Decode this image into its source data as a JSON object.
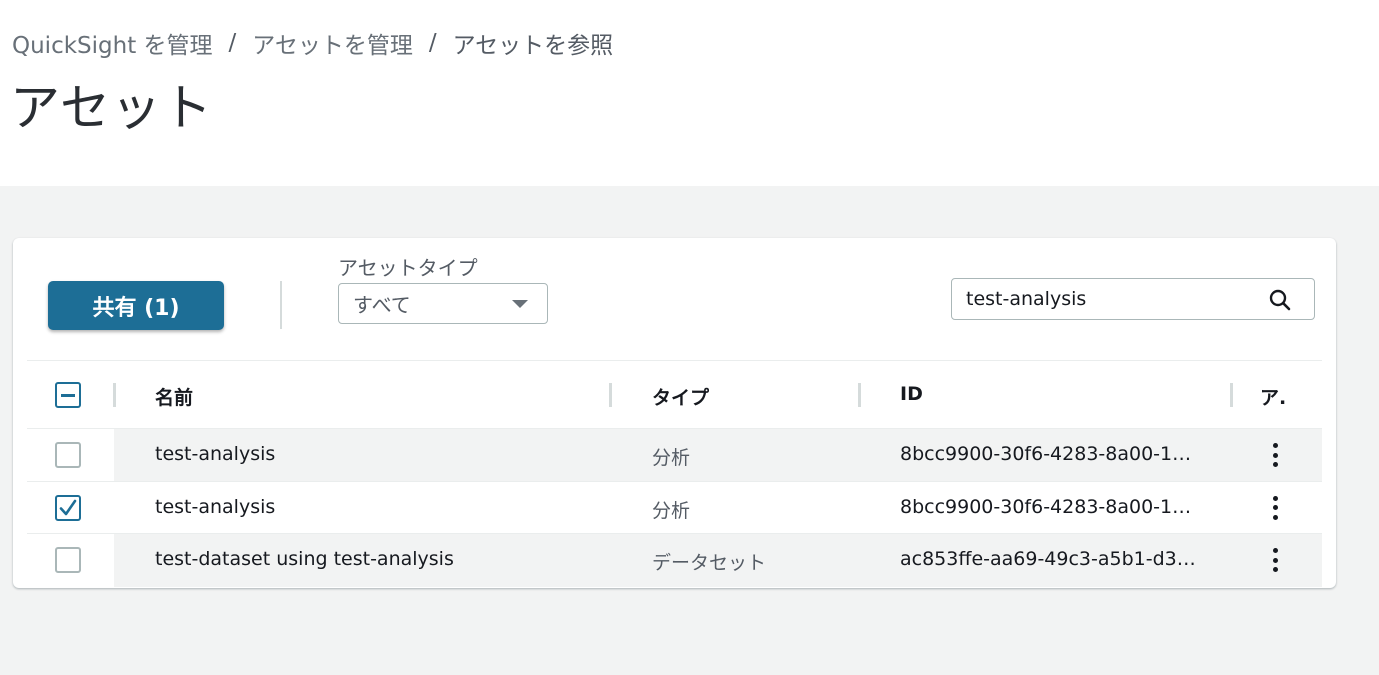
{
  "breadcrumb": {
    "items": [
      "QuickSight を管理",
      "アセットを管理",
      "アセットを参照"
    ],
    "separator": "/"
  },
  "page": {
    "title": "アセット"
  },
  "toolbar": {
    "share_label": "共有 (1)",
    "asset_type_label": "アセットタイプ",
    "asset_type_selected": "すべて",
    "search_value": "test-analysis"
  },
  "table": {
    "columns": [
      "名前",
      "タイプ",
      "ID",
      "ア."
    ],
    "rows": [
      {
        "name": "test-analysis",
        "type": "分析",
        "id": "8bcc9900-30f6-4283-8a00-1…",
        "checked": false
      },
      {
        "name": "test-analysis",
        "type": "分析",
        "id": "8bcc9900-30f6-4283-8a00-1…",
        "checked": true
      },
      {
        "name": "test-dataset using test-analysis",
        "type": "データセット",
        "id": "ac853ffe-aa69-49c3-a5b1-d3…",
        "checked": false
      }
    ]
  },
  "colors": {
    "primary": "#1d6e96",
    "content_bg": "#f2f3f3",
    "text": "#16191f",
    "muted_text": "#545b64"
  },
  "icons": {
    "search": "search-icon",
    "select_caret": "caret-down-icon",
    "row_actions": "more-vertical-icon",
    "check": "check-icon"
  }
}
